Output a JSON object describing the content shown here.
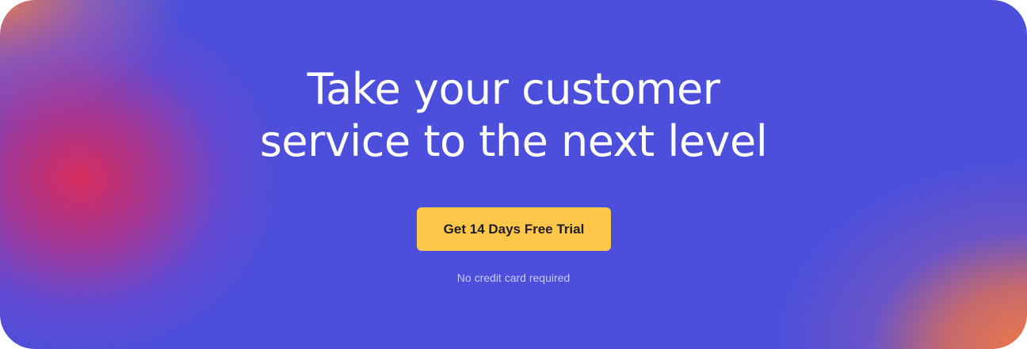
{
  "banner": {
    "headline_line1": "Take your customer",
    "headline_line2": "service to the next level",
    "cta_label": "Get 14 Days Free Trial",
    "note": "No credit card required"
  },
  "colors": {
    "background": "#4c4fdb",
    "accent_pink": "#d62c5c",
    "accent_orange": "#ec7848",
    "button": "#fdc84a",
    "button_text": "#1d1d2a",
    "headline_text": "#ffffff",
    "note_text": "#c9ccf5"
  }
}
